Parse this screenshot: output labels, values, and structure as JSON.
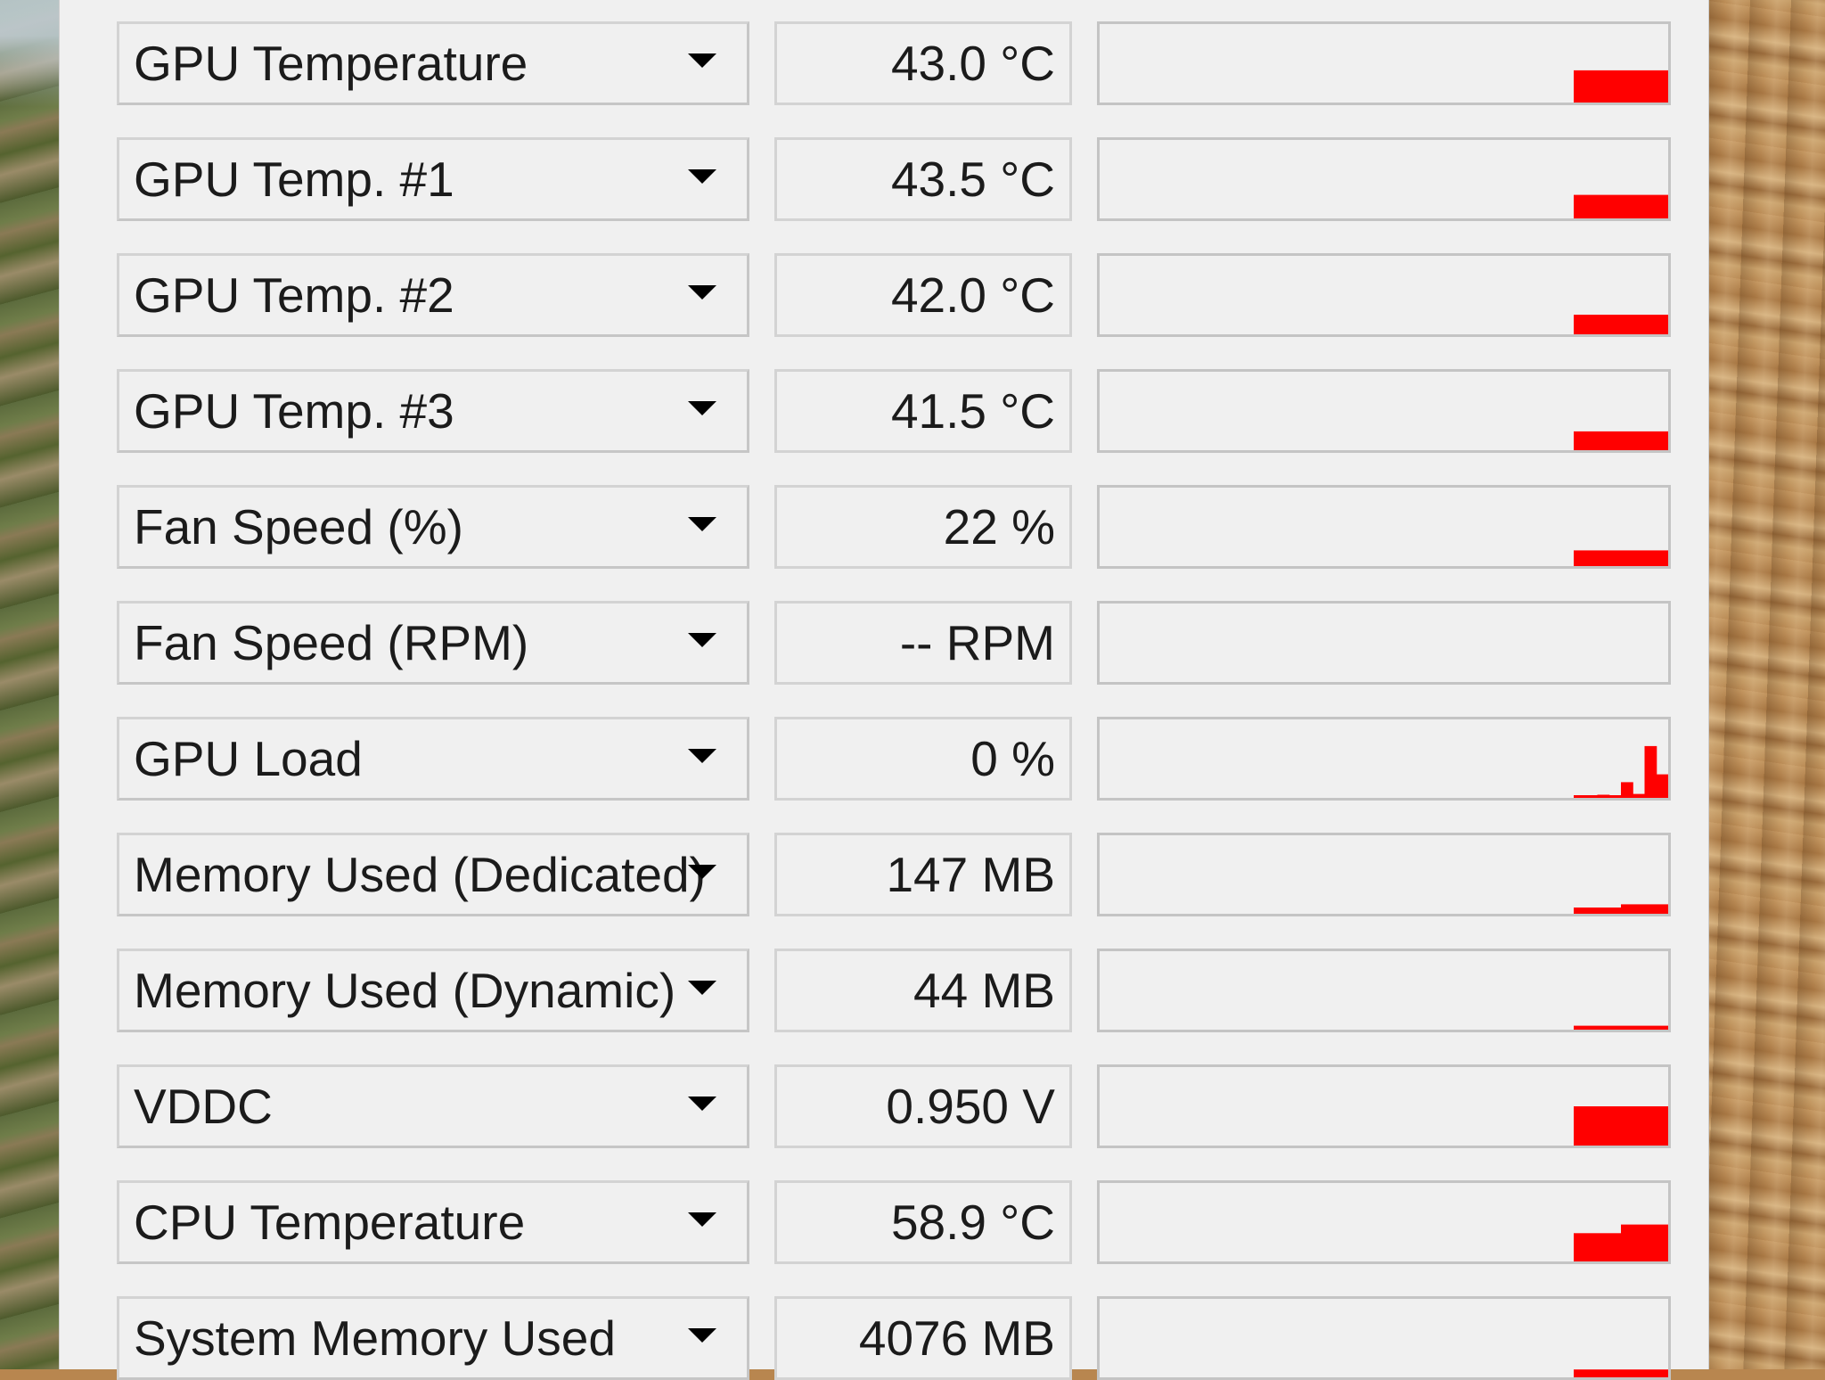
{
  "colors": {
    "graph_line": "#ff0000",
    "panel_background": "#f0f0f0",
    "field_border": "#d3d3d3"
  },
  "sensors": [
    {
      "label": "GPU Temperature",
      "value": "43.0 °C",
      "icon": "chevron-down-icon",
      "history_level": [
        0.41
      ]
    },
    {
      "label": "GPU Temp. #1",
      "value": "43.5 °C",
      "icon": "chevron-down-icon",
      "history_level": [
        0.3
      ]
    },
    {
      "label": "GPU Temp. #2",
      "value": "42.0 °C",
      "icon": "chevron-down-icon",
      "history_level": [
        0.25
      ]
    },
    {
      "label": "GPU Temp. #3",
      "value": "41.5 °C",
      "icon": "chevron-down-icon",
      "history_level": [
        0.24
      ]
    },
    {
      "label": "Fan Speed (%)",
      "value": "22 %",
      "icon": "chevron-down-icon",
      "history_level": [
        0.2
      ]
    },
    {
      "label": "Fan Speed (RPM)",
      "value": "-- RPM",
      "icon": "chevron-down-icon",
      "history_level": []
    },
    {
      "label": "GPU Load",
      "value": "0 %",
      "icon": "chevron-down-icon",
      "history_level": [
        0.03,
        0.0,
        0.04,
        0.0,
        0.2,
        0.05,
        0.66,
        0.3
      ]
    },
    {
      "label": "Memory Used (Dedicated)",
      "value": "147 MB",
      "icon": "chevron-down-icon",
      "history_level": [
        0.08,
        0.12
      ]
    },
    {
      "label": "Memory Used (Dynamic)",
      "value": "44 MB",
      "icon": "chevron-down-icon",
      "history_level": [
        0.05
      ]
    },
    {
      "label": "VDDC",
      "value": "0.950 V",
      "icon": "chevron-down-icon",
      "history_level": [
        0.5,
        0.5,
        0.5
      ]
    },
    {
      "label": "CPU Temperature",
      "value": "58.9 °C",
      "icon": "chevron-down-icon",
      "history_level": [
        0.36,
        0.47
      ]
    },
    {
      "label": "System Memory Used",
      "value": "4076 MB",
      "icon": "chevron-down-icon",
      "history_level": [
        0.1
      ]
    }
  ]
}
